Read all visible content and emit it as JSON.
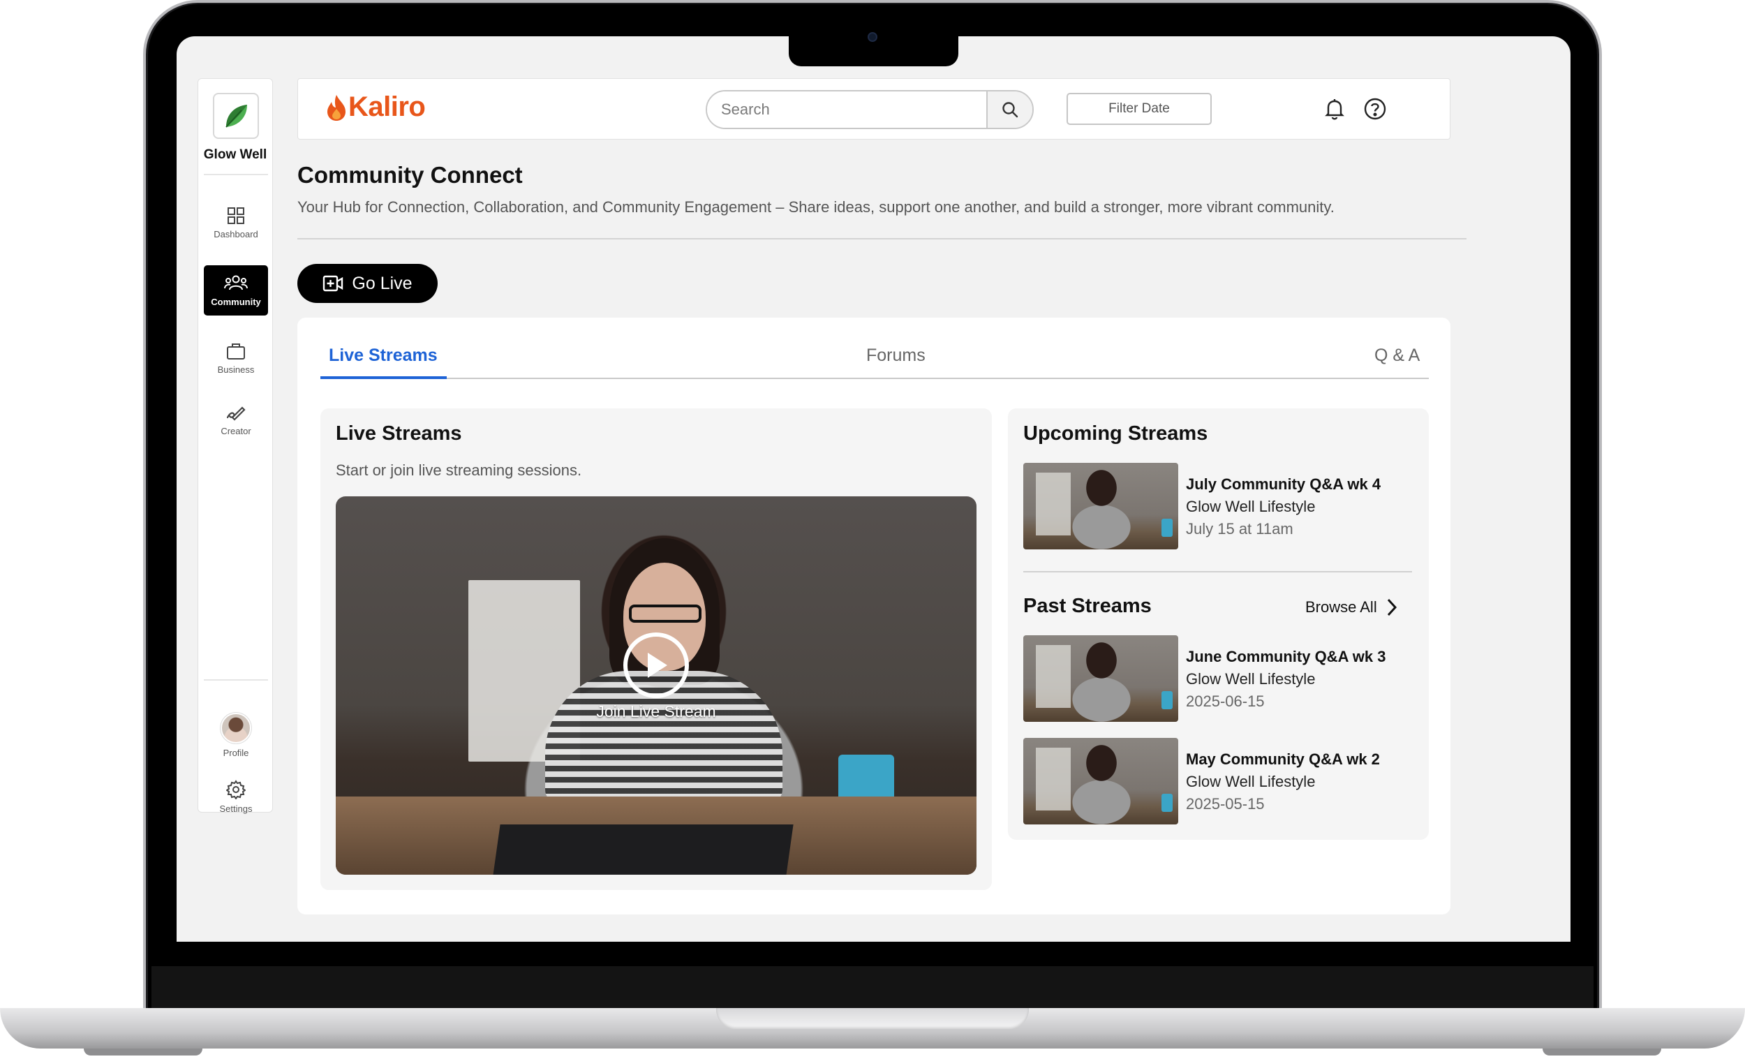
{
  "sidebar": {
    "brand": "Glow Well",
    "nav": [
      {
        "label": "Dashboard",
        "icon": "grid-icon"
      },
      {
        "label": "Community",
        "icon": "people-icon"
      },
      {
        "label": "Business",
        "icon": "briefcase-icon"
      },
      {
        "label": "Creator",
        "icon": "pen-icon"
      }
    ],
    "bottom": [
      {
        "label": "Profile",
        "icon": "avatar"
      },
      {
        "label": "Settings",
        "icon": "gear-icon"
      }
    ]
  },
  "topbar": {
    "logo_text": "Kaliro",
    "search_placeholder": "Search",
    "filter_label": "Filter Date",
    "icons": [
      "bell-icon",
      "help-icon"
    ]
  },
  "header": {
    "title": "Community Connect",
    "subtitle": "Your Hub for Connection, Collaboration, and Community Engagement –  Share ideas, support one another, and build a stronger, more vibrant community.",
    "go_live_label": "Go Live"
  },
  "tabs": [
    {
      "label": "Live Streams",
      "active": true
    },
    {
      "label": "Forums",
      "active": false
    },
    {
      "label": "Q & A",
      "active": false
    }
  ],
  "live_panel": {
    "title": "Live Streams",
    "subtitle": "Start or join live streaming sessions.",
    "join_label": "Join Live Stream"
  },
  "upcoming": {
    "title": "Upcoming Streams",
    "items": [
      {
        "title": "July Community Q&A wk 4",
        "org": "Glow Well Lifestyle",
        "date": "July 15 at 11am"
      }
    ]
  },
  "past": {
    "title": "Past Streams",
    "browse_label": "Browse All",
    "items": [
      {
        "title": "June Community Q&A wk 3",
        "org": "Glow Well Lifestyle",
        "date": "2025-06-15"
      },
      {
        "title": "May Community Q&A wk 2",
        "org": "Glow Well Lifestyle",
        "date": "2025-05-15"
      }
    ]
  },
  "colors": {
    "accent_blue": "#1e63d6",
    "brand_orange": "#e8561a",
    "brand_green": "#4caf50",
    "active_nav": "#000000"
  }
}
